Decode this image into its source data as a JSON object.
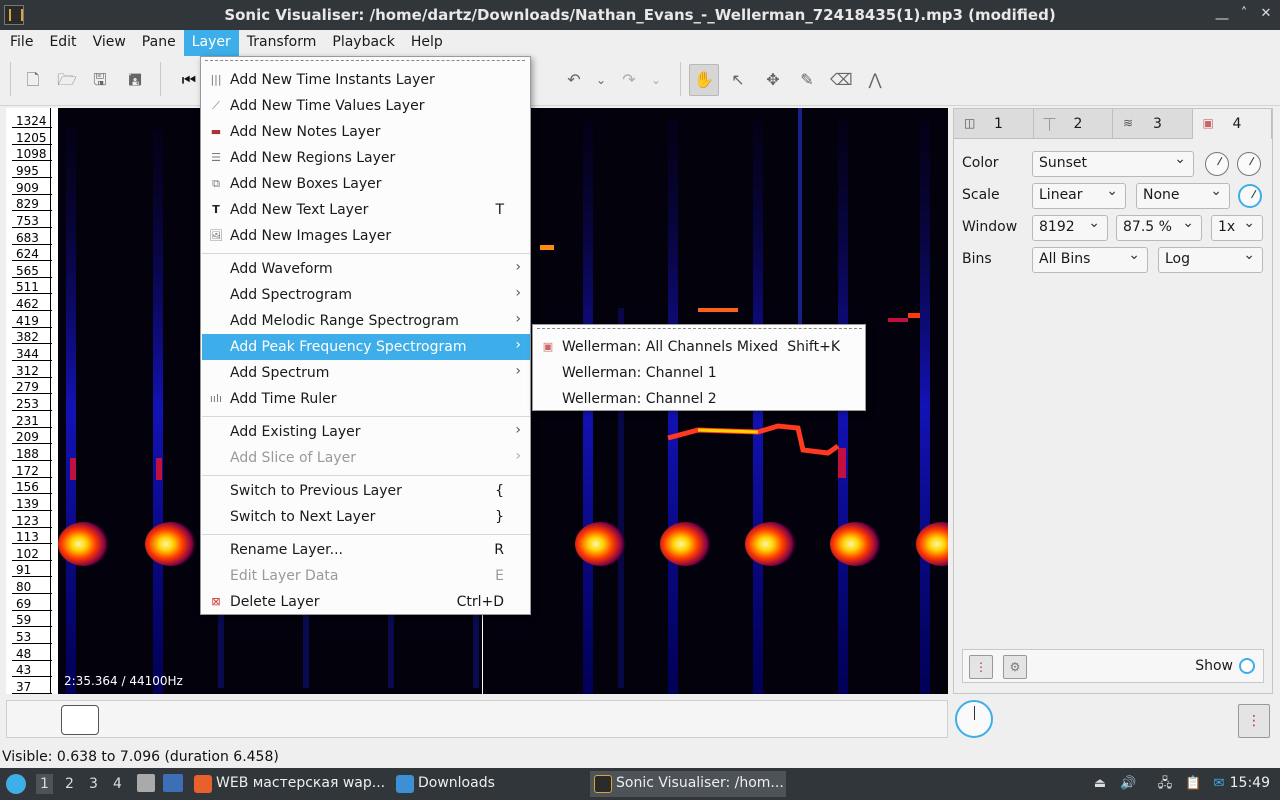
{
  "window": {
    "title": "Sonic Visualiser: /home/dartz/Downloads/Nathan_Evans_-_Wellerman_72418435(1).mp3 (modified)",
    "controls": [
      "⎽",
      "˄",
      "✕"
    ]
  },
  "menubar": [
    "File",
    "Edit",
    "View",
    "Pane",
    "Layer",
    "Transform",
    "Playback",
    "Help"
  ],
  "layer_menu": {
    "items": [
      {
        "label": "Add New Time Instants Layer",
        "icon": "time-instants-icon"
      },
      {
        "label": "Add New Time Values Layer",
        "icon": "time-values-icon"
      },
      {
        "label": "Add New Notes Layer",
        "icon": "notes-icon"
      },
      {
        "label": "Add New Regions Layer",
        "icon": "regions-icon"
      },
      {
        "label": "Add New Boxes Layer",
        "icon": "boxes-icon"
      },
      {
        "label": "Add New Text Layer",
        "shortcut": "T",
        "icon": "text-icon"
      },
      {
        "label": "Add New Images Layer",
        "icon": "images-icon"
      },
      {
        "label": "Add Waveform"
      },
      {
        "label": "Add Spectrogram"
      },
      {
        "label": "Add Melodic Range Spectrogram"
      },
      {
        "label": "Add Peak Frequency Spectrogram"
      },
      {
        "label": "Add Spectrum"
      },
      {
        "label": "Add Time Ruler",
        "icon": "time-ruler-icon"
      },
      {
        "label": "Add Existing Layer"
      },
      {
        "label": "Add Slice of Layer"
      },
      {
        "label": "Switch to Previous Layer",
        "shortcut": "{"
      },
      {
        "label": "Switch to Next Layer",
        "shortcut": "}"
      },
      {
        "label": "Rename Layer...",
        "shortcut": "R"
      },
      {
        "label": "Edit Layer Data",
        "shortcut": "E"
      },
      {
        "label": "Delete Layer",
        "shortcut": "Ctrl+D",
        "icon": "delete-icon"
      }
    ]
  },
  "submenu": {
    "items": [
      {
        "label": "Wellerman: All Channels Mixed",
        "shortcut": "Shift+K"
      },
      {
        "label": "Wellerman: Channel 1"
      },
      {
        "label": "Wellerman: Channel 2"
      }
    ]
  },
  "freq_scale": [
    "1324",
    "1205",
    "1098",
    "995",
    "909",
    "829",
    "753",
    "683",
    "624",
    "565",
    "511",
    "462",
    "419",
    "382",
    "344",
    "312",
    "279",
    "253",
    "231",
    "209",
    "188",
    "172",
    "156",
    "139",
    "123",
    "113",
    "102",
    "91",
    "80",
    "69",
    "59",
    "53",
    "48",
    "43",
    "37"
  ],
  "time_readout": "2:35.364 / 44100Hz",
  "properties": {
    "tabs": [
      "1",
      "2",
      "3",
      "4"
    ],
    "color_label": "Color",
    "color_value": "Sunset",
    "scale_label": "Scale",
    "scale_value": "Linear",
    "scale_norm": "None",
    "window_label": "Window",
    "window_size": "8192",
    "window_overlap": "87.5 %",
    "window_zoom": "1x",
    "bins_label": "Bins",
    "bins_value": "All Bins",
    "bins_scale": "Log",
    "show_label": "Show"
  },
  "status": "Visible: 0.638 to 7.096 (duration 6.458)",
  "taskbar": {
    "workspaces": [
      "1",
      "2",
      "3",
      "4"
    ],
    "tasks": [
      "WEB мастерская wap...",
      "Downloads",
      "Sonic Visualiser: /hom..."
    ],
    "clock": "15:49"
  },
  "colors": {
    "accent": "#3daee9",
    "titlebar": "#31363b"
  }
}
